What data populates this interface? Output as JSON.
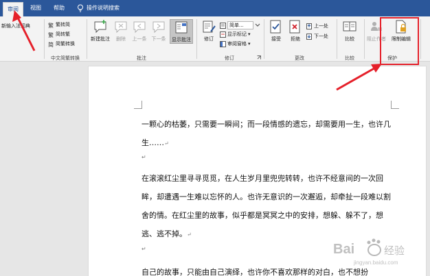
{
  "tabs": [
    {
      "label": "审阅",
      "active": true
    },
    {
      "label": "视图",
      "active": false
    },
    {
      "label": "帮助",
      "active": false
    }
  ],
  "tell_me": "操作说明搜索",
  "ribbon": {
    "partial_left": "新输入法词典",
    "chinese_conversion": {
      "label": "中文简繁转换",
      "items": [
        "繁转简",
        "简转繁",
        "简繁转换"
      ]
    },
    "comments": {
      "label": "批注",
      "new": "新建批注",
      "delete": "删除",
      "previous": "上一条",
      "next": "下一条",
      "show": "显示批注"
    },
    "tracking": {
      "label": "修订",
      "track": "修订",
      "display_select": "简单...",
      "show_markup": "显示标记",
      "reviewing_pane": "审阅窗格"
    },
    "changes": {
      "label": "更改",
      "accept": "接受",
      "reject": "拒绝",
      "prev": "上一处",
      "next": "下一处"
    },
    "compare": {
      "label": "比较",
      "button": "比较"
    },
    "protect": {
      "label": "保护",
      "block_authors": "阻止作者",
      "restrict_editing": "限制编辑"
    }
  },
  "document": {
    "paragraphs": [
      "一颗心的枯萎，只需要一瞬间；而一段情感的遗忘，却需要用一生，也许几生……",
      "在滚滚红尘里寻寻觅觅，在人生岁月里兜兜转转，也许不经意间的一次回眸，却遭遇一生难以忘怀的人。也许无意识的一次邂逅，却牵扯一段难以割舍的情。在红尘里的故事，似乎都是冥冥之中的安排，想躲、躲不了，想逃、逃不掉。",
      "自己的故事，只能由自己演绎，也许你不喜欢那样的对白，也不想扮"
    ]
  },
  "watermark": {
    "brand": "Bai",
    "suffix": "经验",
    "site": "jingyan.baidu.com"
  },
  "colors": {
    "accent": "#2b579a",
    "callout": "#e5202a"
  }
}
